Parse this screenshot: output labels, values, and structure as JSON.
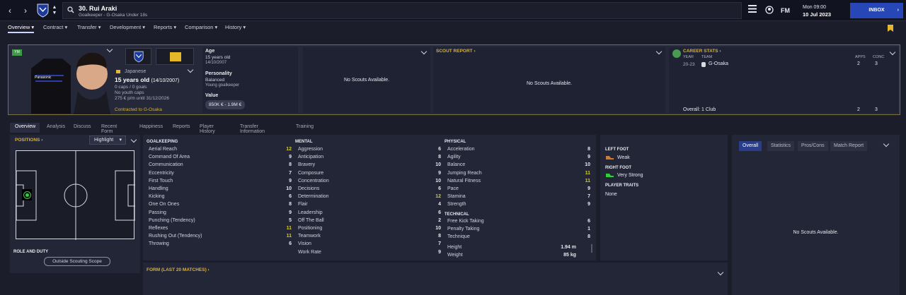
{
  "topbar": {
    "player_name": "30. Rui Araki",
    "player_sub": "Goalkeeper - G-Osaka Under 18s",
    "fm_label": "FM",
    "day_time": "Mon 09:00",
    "date": "10 Jul 2023",
    "inbox_label": "INBOX"
  },
  "menu": [
    "Overview",
    "Contract",
    "Transfer",
    "Development",
    "Reports",
    "Comparison",
    "History"
  ],
  "header": {
    "badge": "YM",
    "nationality": "Japanese",
    "age_line": "15 years old",
    "dob": "(14/10/2007)",
    "caps": "0 caps / 0 goals",
    "youth_caps": "No youth caps",
    "wage": "275 € p/m until 31/12/2026",
    "contracted": "Contracted to G-Osaka",
    "age_label": "Age",
    "age_value": "15 years old",
    "age_dob": "14/10/2007",
    "personality_label": "Personality",
    "personality_value": "Balanced",
    "personality_sub": "Young goalkeeper",
    "value_label": "Value",
    "value_value": "850K € - 1.9M €",
    "no_scouts": "No Scouts Available.",
    "scout_report": "SCOUT REPORT",
    "career_stats": "CAREER STATS",
    "year_h": "YEAR",
    "team_h": "TEAM",
    "apps_h": "APPS",
    "conc_h": "CONC",
    "year": "20-23",
    "team": "G-Osaka",
    "apps": "2",
    "conc": "3",
    "overall_label": "Overall: 1 Club",
    "overall_apps": "2",
    "overall_conc": "3"
  },
  "subtabs": [
    "Overview",
    "Analysis",
    "Discuss",
    "Recent Form",
    "Happiness",
    "Reports",
    "Player History",
    "Transfer Information",
    "Training"
  ],
  "positions": {
    "title": "POSITIONS",
    "highlight": "Highlight",
    "role_duty": "ROLE AND DUTY",
    "outside_scouting": "Outside Scouting Scope"
  },
  "attributes": {
    "goalkeeping_title": "GOALKEEPING",
    "mental_title": "MENTAL",
    "physical_title": "PHYSICAL",
    "technical_title": "TECHNICAL",
    "goalkeeping": [
      {
        "name": "Aerial Reach",
        "value": "12",
        "hi": true
      },
      {
        "name": "Command Of Area",
        "value": "9"
      },
      {
        "name": "Communication",
        "value": "8"
      },
      {
        "name": "Eccentricity",
        "value": "7"
      },
      {
        "name": "First Touch",
        "value": "9"
      },
      {
        "name": "Handling",
        "value": "10"
      },
      {
        "name": "Kicking",
        "value": "6"
      },
      {
        "name": "One On Ones",
        "value": "8"
      },
      {
        "name": "Passing",
        "value": "9"
      },
      {
        "name": "Punching (Tendency)",
        "value": "5"
      },
      {
        "name": "Reflexes",
        "value": "11",
        "hi": true
      },
      {
        "name": "Rushing Out (Tendency)",
        "value": "11",
        "hi": true
      },
      {
        "name": "Throwing",
        "value": "6"
      }
    ],
    "mental": [
      {
        "name": "Aggression",
        "value": "6"
      },
      {
        "name": "Anticipation",
        "value": "8"
      },
      {
        "name": "Bravery",
        "value": "10"
      },
      {
        "name": "Composure",
        "value": "9"
      },
      {
        "name": "Concentration",
        "value": "10"
      },
      {
        "name": "Decisions",
        "value": "6"
      },
      {
        "name": "Determination",
        "value": "12",
        "hi": true
      },
      {
        "name": "Flair",
        "value": "4"
      },
      {
        "name": "Leadership",
        "value": "6"
      },
      {
        "name": "Off The Ball",
        "value": "2"
      },
      {
        "name": "Positioning",
        "value": "10"
      },
      {
        "name": "Teamwork",
        "value": "8"
      },
      {
        "name": "Vision",
        "value": "7"
      },
      {
        "name": "Work Rate",
        "value": "9"
      }
    ],
    "physical": [
      {
        "name": "Acceleration",
        "value": "8"
      },
      {
        "name": "Agility",
        "value": "9"
      },
      {
        "name": "Balance",
        "value": "10"
      },
      {
        "name": "Jumping Reach",
        "value": "11",
        "hi": true
      },
      {
        "name": "Natural Fitness",
        "value": "11",
        "hi": true
      },
      {
        "name": "Pace",
        "value": "9"
      },
      {
        "name": "Stamina",
        "value": "7"
      },
      {
        "name": "Strength",
        "value": "9"
      }
    ],
    "technical": [
      {
        "name": "Free Kick Taking",
        "value": "6"
      },
      {
        "name": "Penalty Taking",
        "value": "1"
      },
      {
        "name": "Technique",
        "value": "8"
      }
    ],
    "height_label": "Height",
    "height": "1.94 m",
    "weight_label": "Weight",
    "weight": "85 kg"
  },
  "form": {
    "title": "FORM (LAST 20 MATCHES)"
  },
  "feet": {
    "left_label": "LEFT FOOT",
    "left_value": "Weak",
    "right_label": "RIGHT FOOT",
    "right_value": "Very Strong",
    "traits_label": "PLAYER TRAITS",
    "traits_value": "None"
  },
  "right": {
    "tabs": [
      "Overall",
      "Statistics",
      "Pros/Cons",
      "Match Report"
    ],
    "no_scouts": "No Scouts Available."
  },
  "colors": {
    "accent": "#2746b8",
    "gold": "#d8b13a",
    "highlight": "#cfc83a",
    "gk_position": "#2ed13a"
  }
}
